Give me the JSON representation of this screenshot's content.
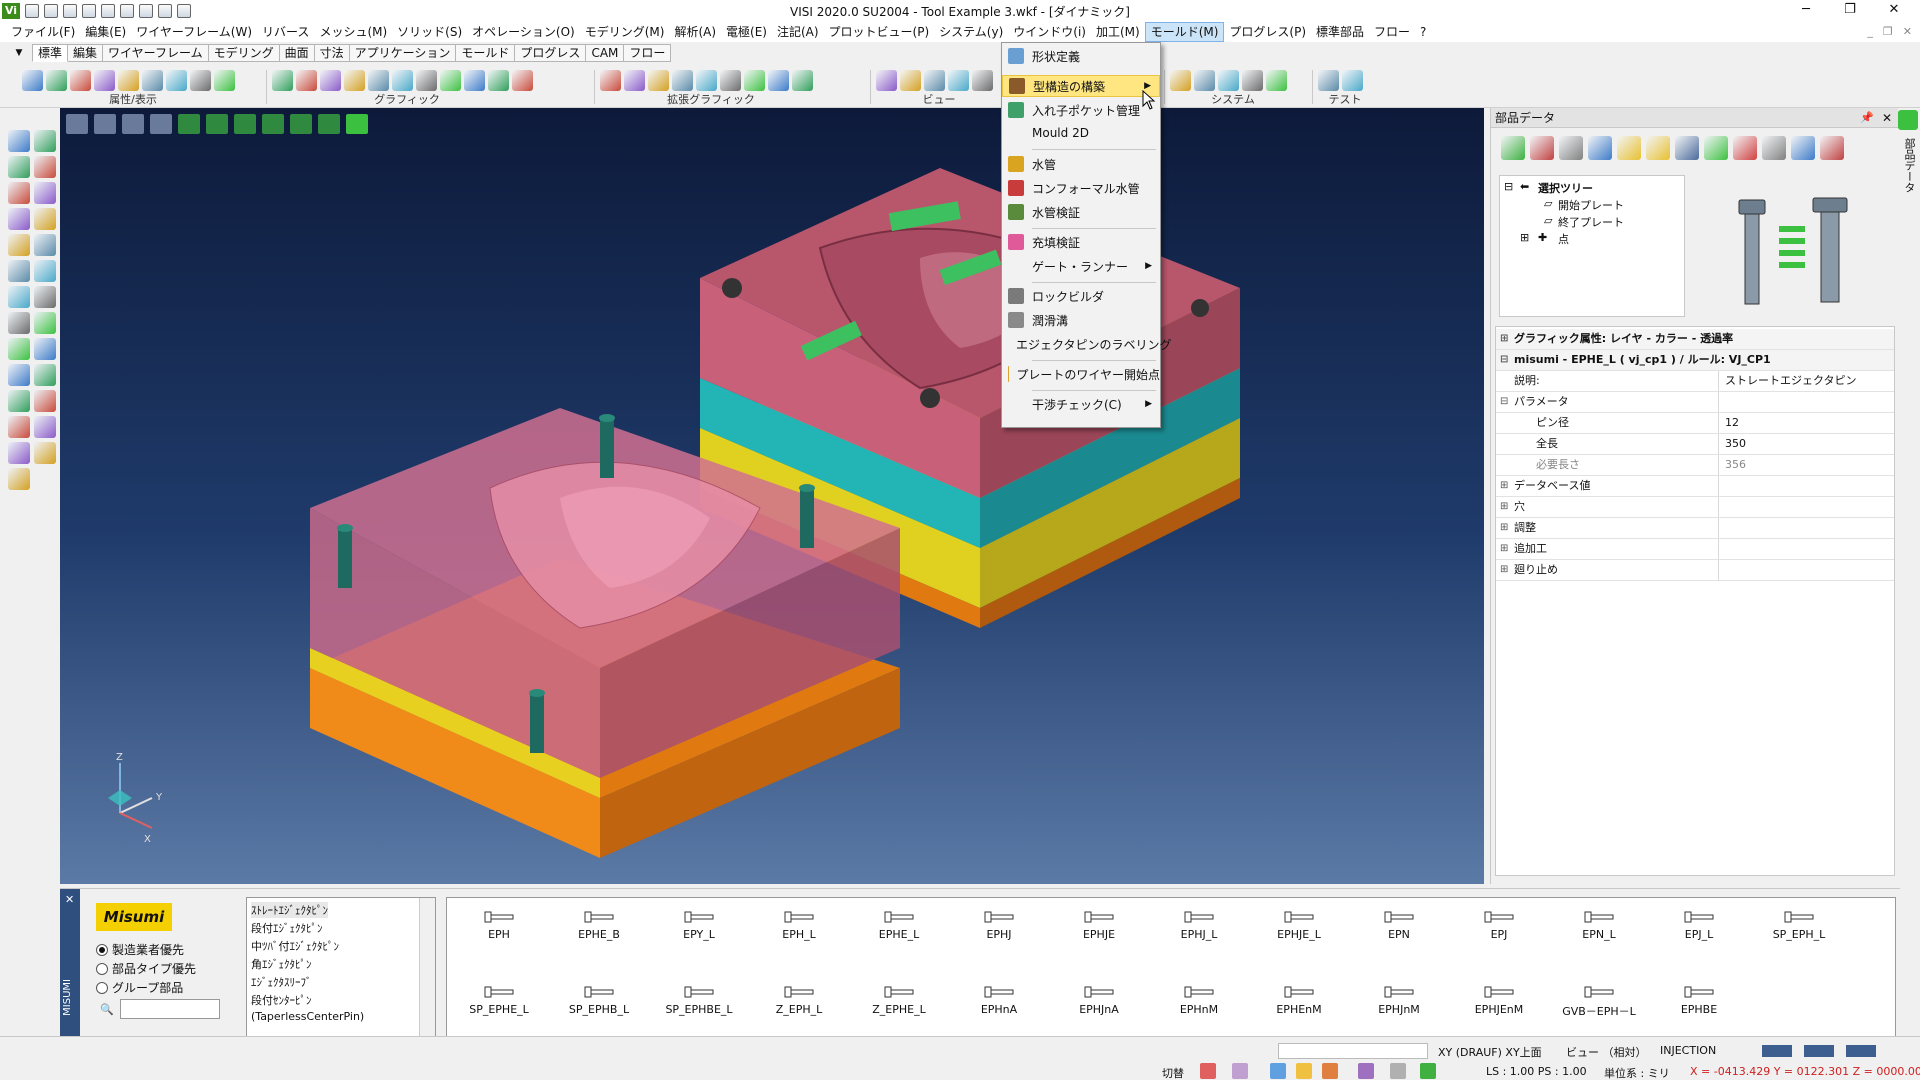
{
  "window": {
    "title": "VISI 2020.0 SU2004 - Tool Example 3.wkf - [ダイナミック]",
    "logo": "Vi",
    "minimize": "─",
    "maximize": "❐",
    "close": "✕"
  },
  "menubar": {
    "items": [
      "ファイル(F)",
      "編集(E)",
      "ワイヤーフレーム(W)",
      "リバース",
      "メッシュ(M)",
      "ソリッド(S)",
      "オペレーション(O)",
      "モデリング(M)",
      "解析(A)",
      "電極(E)",
      "注記(A)",
      "プロットビュー(P)",
      "システム(y)",
      "ウインドウ(i)",
      "加工(M)",
      "モールド(M)",
      "プログレス(P)",
      "標準部品",
      "フロー",
      "?"
    ],
    "active_index": 15,
    "mdi_min": "_",
    "mdi_restore": "❐",
    "mdi_close": "✕"
  },
  "tabs": {
    "items": [
      "標準",
      "編集",
      "ワイヤーフレーム",
      "モデリング",
      "曲面",
      "寸法",
      "アプリケーション",
      "モールド",
      "プログレス",
      "CAM",
      "フロー"
    ],
    "active_index": 0,
    "dropdown": "▼"
  },
  "toolbar": {
    "groups": [
      {
        "label": "属性/表示"
      },
      {
        "label": "グラフィック"
      },
      {
        "label": "拡張グラフィック"
      },
      {
        "label": "ビュー"
      },
      {
        "label": "システム"
      },
      {
        "label": "テスト"
      }
    ]
  },
  "mold_menu": {
    "items": [
      {
        "label": "形状定義",
        "icon": "shape-define-icon",
        "color": "#6a9fd4"
      },
      {
        "label": "型構造の構築",
        "icon": "mold-build-icon",
        "color": "#8b5a2b",
        "highlighted": true,
        "submenu": true
      },
      {
        "label": "入れ子ポケット管理",
        "icon": "insert-pocket-icon",
        "color": "#3fa06a"
      },
      {
        "label": "Mould 2D",
        "icon": "",
        "color": ""
      },
      {
        "label": "水管",
        "icon": "water-pipe-icon",
        "color": "#d9a520"
      },
      {
        "label": "コンフォーマル水管",
        "icon": "conformal-pipe-icon",
        "color": "#c83c3c"
      },
      {
        "label": "水管検証",
        "icon": "pipe-check-icon",
        "color": "#5a8a3c"
      },
      {
        "label": "充填検証",
        "icon": "fill-check-icon",
        "color": "#e05a9a"
      },
      {
        "label": "ゲート・ランナー",
        "icon": "",
        "color": "",
        "submenu": true
      },
      {
        "label": "ロックビルダ",
        "icon": "lock-builder-icon",
        "color": "#7a7a7a"
      },
      {
        "label": "潤滑溝",
        "icon": "lube-groove-icon",
        "color": "#8a8a8a"
      },
      {
        "label": "エジェクタピンのラベリング",
        "icon": "ejector-label-icon",
        "color": "#4a6a9a"
      },
      {
        "label": "プレートのワイヤー開始点",
        "icon": "wire-start-icon",
        "color": "#e0a030"
      },
      {
        "label": "干渉チェック(C)",
        "icon": "",
        "color": "",
        "submenu": true
      }
    ],
    "arrow": "▶"
  },
  "part_panel": {
    "title": "部品データ",
    "pin": "📌",
    "close": "✕",
    "side_label": "部品データ",
    "tree": {
      "root": "選択ツリー",
      "children": [
        "開始プレート",
        "終了プレート",
        "点"
      ]
    },
    "properties": [
      {
        "name": "グラフィック属性: レイヤ - カラー - 透過率",
        "value": "",
        "exp": "⊞",
        "header": true
      },
      {
        "name": "misumi - EPHE_L ( vj_cp1 ) / ルール: VJ_CP1",
        "value": "",
        "exp": "⊟",
        "header": true
      },
      {
        "name": "説明:",
        "value": "ストレートエジェクタピン",
        "exp": ""
      },
      {
        "name": "パラメータ",
        "value": "",
        "exp": "⊟"
      },
      {
        "name": "ピン径",
        "value": "12",
        "exp": "",
        "indent": true
      },
      {
        "name": "全長",
        "value": "350",
        "exp": "",
        "indent": true
      },
      {
        "name": "必要長さ",
        "value": "356",
        "exp": "",
        "indent": true,
        "dim": true
      },
      {
        "name": "データベース値",
        "value": "",
        "exp": "⊞"
      },
      {
        "name": "穴",
        "value": "",
        "exp": "⊞"
      },
      {
        "name": "調整",
        "value": "",
        "exp": "⊞"
      },
      {
        "name": "追加工",
        "value": "",
        "exp": "⊞"
      },
      {
        "name": "廻り止め",
        "value": "",
        "exp": "⊞"
      }
    ]
  },
  "misumi": {
    "side_label": "MISUMI",
    "side_close": "✕",
    "logo": "Misumi",
    "radios": [
      {
        "label": "製造業者優先",
        "checked": true
      },
      {
        "label": "部品タイプ優先",
        "checked": false
      },
      {
        "label": "グループ部品",
        "checked": false
      }
    ],
    "search_icon": "🔍",
    "search_value": "",
    "types": [
      "ｽﾄﾚｰﾄｴｼﾞｪｸﾀﾋﾟﾝ",
      "段付ｴｼﾞｪｸﾀﾋﾟﾝ",
      "中ﾂﾊﾞ付ｴｼﾞｪｸﾀﾋﾟﾝ",
      "角ｴｼﾞｪｸﾀﾋﾟﾝ",
      "ｴｼﾞｪｸﾀｽﾘｰﾌﾞ",
      "段付ｾﾝﾀｰﾋﾟﾝ",
      "(TaperlessCenterPin)"
    ],
    "parts_row1": [
      "EPH",
      "EPHE_B",
      "EPY_L",
      "EPH_L",
      "EPHE_L",
      "EPHJ",
      "EPHJE",
      "EPHJ_L",
      "EPHJE_L",
      "EPN",
      "EPJ",
      "EPN_L",
      "EPJ_L",
      "SP_EPH_L"
    ],
    "parts_row2": [
      "SP_EPHE_L",
      "SP_EPHB_L",
      "SP_EPHBE_L",
      "Z_EPH_L",
      "Z_EPHE_L",
      "EPHnA",
      "EPHJnA",
      "EPHnM",
      "EPHEnM",
      "EPHJnM",
      "EPHJEnM",
      "GVB－EPH－L",
      "EPHBE"
    ]
  },
  "status": {
    "plane": "XY (DRAUF) XY上面",
    "view": "ビュー （相対）",
    "mode": "INJECTION",
    "switch": "切替",
    "ls": "LS : 1.00 PS : 1.00",
    "unit": "単位系 : ミリ",
    "coords": "X = -0413.429 Y = 0122.301 Z = 0000.000"
  },
  "axis": {
    "z": "Z",
    "x": "X",
    "y": "Y"
  }
}
